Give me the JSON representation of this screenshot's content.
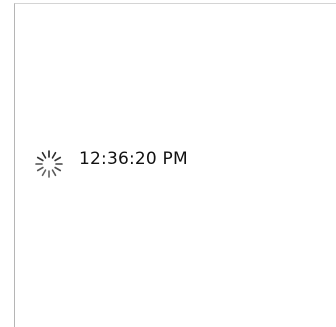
{
  "status": {
    "time": "12:36:20 PM",
    "spinner_icon": "loading-spinner-icon"
  },
  "colors": {
    "background": "#ffffff",
    "text": "#111111",
    "frame_border": "#b5b5b5",
    "spinner": "#222222"
  }
}
